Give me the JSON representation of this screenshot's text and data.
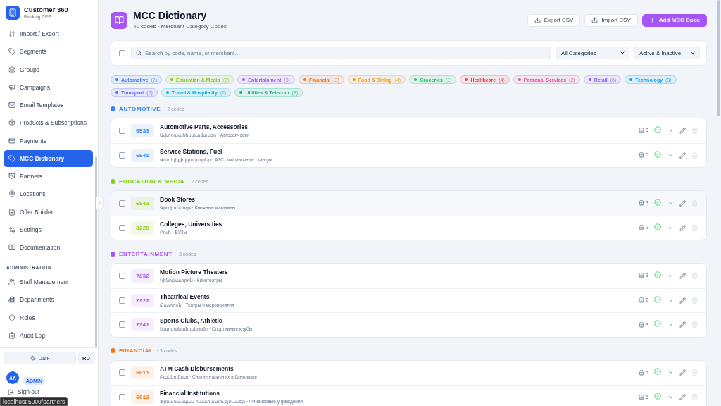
{
  "sidebar": {
    "brand": {
      "title": "Customer 360",
      "subtitle": "Banking CEP"
    },
    "groups": [
      {
        "items": [
          {
            "label": "Import / Export",
            "selected": false
          },
          {
            "label": "Segments",
            "selected": false
          },
          {
            "label": "Groups",
            "selected": false
          },
          {
            "label": "Campaigns",
            "selected": false
          },
          {
            "label": "Email Templates",
            "selected": false
          },
          {
            "label": "Products & Subscriptions",
            "selected": false
          },
          {
            "label": "Payments",
            "selected": false
          },
          {
            "label": "MCC Dictionary",
            "selected": true
          },
          {
            "label": "Partners",
            "selected": false
          },
          {
            "label": "Locations",
            "selected": false
          },
          {
            "label": "Offer Builder",
            "selected": false
          },
          {
            "label": "Settings",
            "selected": false
          },
          {
            "label": "Documentation",
            "selected": false
          }
        ]
      },
      {
        "heading": "ADMINISTRATION",
        "items": [
          {
            "label": "Staff Management",
            "selected": false
          },
          {
            "label": "Departments",
            "selected": false
          },
          {
            "label": "Roles",
            "selected": false
          },
          {
            "label": "Audit Log",
            "selected": false
          }
        ]
      }
    ],
    "theme_button": "Dark",
    "language_button": "RU",
    "user": {
      "initials": "AA",
      "role": "ADMIN"
    },
    "sign_out": "Sign out"
  },
  "header": {
    "title": "MCC Dictionary",
    "subtitle": "40 codes · Merchant Category Codes",
    "buttons": [
      {
        "label": "Export CSV",
        "kind": "export"
      },
      {
        "label": "Import CSV",
        "kind": "import"
      },
      {
        "label": "Add MCC Code",
        "kind": "add"
      }
    ]
  },
  "filters": {
    "select_all": {
      "checked": false
    },
    "search": {
      "placeholder": "Search by code, name, or merchant…"
    },
    "category": {
      "value": "All Categories"
    },
    "status": {
      "value": "Active & Inactive"
    }
  },
  "chips": [
    {
      "label": "Automotive",
      "count": "(2)",
      "color": "#3b82f6"
    },
    {
      "label": "Education & Media",
      "count": "(2)",
      "color": "#84cc16"
    },
    {
      "label": "Entertainment",
      "count": "(3)",
      "color": "#a855f7"
    },
    {
      "label": "Financial",
      "count": "(3)",
      "color": "#f97316"
    },
    {
      "label": "Food & Dining",
      "count": "(4)",
      "color": "#f59e0b"
    },
    {
      "label": "Groceries",
      "count": "(1)",
      "color": "#22c55e"
    },
    {
      "label": "Healthcare",
      "count": "(4)",
      "color": "#ef4444"
    },
    {
      "label": "Personal Services",
      "count": "(2)",
      "color": "#ec4899"
    },
    {
      "label": "Retail",
      "count": "(6)",
      "color": "#8b5cf6"
    },
    {
      "label": "Technology",
      "count": "(3)",
      "color": "#0ea5e9"
    },
    {
      "label": "Transport",
      "count": "(5)",
      "color": "#6366f1"
    },
    {
      "label": "Travel & Hospitality",
      "count": "(2)",
      "color": "#06b6d4"
    },
    {
      "label": "Utilities & Telecom",
      "count": "(3)",
      "color": "#10b981"
    }
  ],
  "sections": [
    {
      "title": "AUTOMOTIVE",
      "count": "· 2 codes",
      "color": "#3b82f6",
      "rows": [
        {
          "code": "5533",
          "name": "Automotive Parts, Accessories",
          "subtitle": "Ավտոպահեստամասեր · Автозапчасти",
          "merchants": "3",
          "active": true,
          "checked": false,
          "highlighted": false
        },
        {
          "code": "5541",
          "name": "Service Stations, Fuel",
          "subtitle": "Վառելիքի լցավայրեր · АЗС, заправочные станции",
          "merchants": "6",
          "active": true,
          "checked": false,
          "highlighted": false
        }
      ]
    },
    {
      "title": "EDUCATION & MEDIA",
      "count": "· 2 codes",
      "color": "#84cc16",
      "rows": [
        {
          "code": "5942",
          "name": "Book Stores",
          "subtitle": "Գրախանութ · Книжные магазины",
          "merchants": "3",
          "active": true,
          "checked": false,
          "highlighted": true
        },
        {
          "code": "8220",
          "name": "Colleges, Universities",
          "subtitle": "Բուհ · ВУЗы",
          "merchants": "2",
          "active": true,
          "checked": false,
          "highlighted": false
        }
      ]
    },
    {
      "title": "ENTERTAINMENT",
      "count": "· 3 codes",
      "color": "#a855f7",
      "rows": [
        {
          "code": "7832",
          "name": "Motion Picture Theaters",
          "subtitle": "Կինոթատրոն · Кинотеатры",
          "merchants": "3",
          "active": true,
          "checked": false,
          "highlighted": false
        },
        {
          "code": "7922",
          "name": "Theatrical Events",
          "subtitle": "Թատրոն · Театры и мероприятия",
          "merchants": "2",
          "active": true,
          "checked": false,
          "highlighted": false
        },
        {
          "code": "7941",
          "name": "Sports Clubs, Athletic",
          "subtitle": "Մարզական ակումբ · Спортивные клубы",
          "merchants": "3",
          "active": true,
          "checked": false,
          "highlighted": false
        }
      ]
    },
    {
      "title": "FINANCIAL",
      "count": "· 3 codes",
      "color": "#f97316",
      "rows": [
        {
          "code": "6011",
          "name": "ATM Cash Disbursements",
          "subtitle": "Բանկոմատ · Снятие наличных в банкомате",
          "merchants": "5",
          "active": true,
          "checked": false,
          "highlighted": false
        },
        {
          "code": "6012",
          "name": "Financial Institutions",
          "subtitle": "Ֆինանսական հաստատություններ · Финансовые учреждения",
          "merchants": "6",
          "active": true,
          "checked": false,
          "highlighted": false
        }
      ]
    }
  ],
  "status_url": "localhost:5000/partners"
}
